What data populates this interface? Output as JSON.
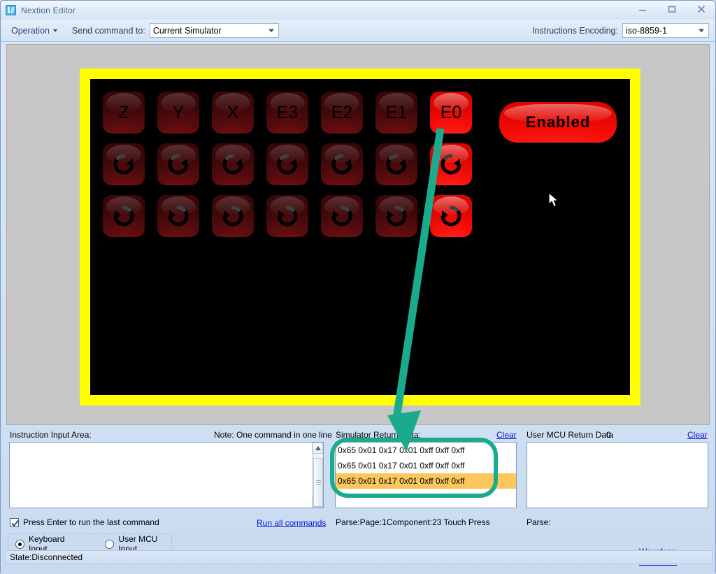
{
  "window": {
    "title": "Nextion Editor",
    "icon": "nextion-logo-icon",
    "minimize": "minimize-icon",
    "maximize": "maximize-icon",
    "close": "close-icon"
  },
  "toolbar": {
    "operation_menu": "Operation",
    "send_command_label": "Send command to:",
    "send_command_value": "Current Simulator",
    "encoding_label": "Instructions Encoding:",
    "encoding_value": "iso-8859-1"
  },
  "simulator": {
    "frame_color": "#ffff00",
    "screen_color": "#000000",
    "lit_color": "#f50d08",
    "dim_color": "#520b0e",
    "rows": [
      {
        "type": "label",
        "buttons": [
          {
            "label": "Z",
            "state": "dim"
          },
          {
            "label": "Y",
            "state": "dim"
          },
          {
            "label": "X",
            "state": "dim"
          },
          {
            "label": "E3",
            "state": "dim"
          },
          {
            "label": "E2",
            "state": "dim"
          },
          {
            "label": "E1",
            "state": "dim"
          },
          {
            "label": "E0",
            "state": "lit"
          }
        ]
      },
      {
        "type": "icon",
        "icon": "rotate-clockwise-icon",
        "buttons": [
          {
            "label": "",
            "state": "dim"
          },
          {
            "label": "",
            "state": "dim"
          },
          {
            "label": "",
            "state": "dim"
          },
          {
            "label": "",
            "state": "dim"
          },
          {
            "label": "",
            "state": "dim"
          },
          {
            "label": "",
            "state": "dim"
          },
          {
            "label": "",
            "state": "lit"
          }
        ]
      },
      {
        "type": "icon",
        "icon": "rotate-counterclockwise-icon",
        "buttons": [
          {
            "label": "",
            "state": "dim"
          },
          {
            "label": "",
            "state": "dim"
          },
          {
            "label": "",
            "state": "dim"
          },
          {
            "label": "",
            "state": "dim"
          },
          {
            "label": "",
            "state": "dim"
          },
          {
            "label": "",
            "state": "dim"
          },
          {
            "label": "",
            "state": "lit"
          }
        ]
      }
    ],
    "enable_button": {
      "label": "Enabled",
      "state": "lit"
    }
  },
  "instruction_panel": {
    "title": "Instruction Input Area:",
    "note": "Note: One command in one line",
    "input_value": "",
    "input_placeholder": "",
    "checkbox_label": "Press Enter to run the last command",
    "checkbox_checked": true,
    "run_all_link": "Run all commands",
    "radio_keyboard": "Keyboard Input",
    "radio_mcu": "User MCU Input",
    "radio_selected": "Keyboard Input"
  },
  "simulator_return": {
    "title": "Simulator Return Data:",
    "count": "3",
    "clear_link": "Clear",
    "rows": [
      {
        "text": "0x65 0x01 0x17 0x01 0xff 0xff 0xff",
        "selected": false
      },
      {
        "text": "0x65 0x01 0x17 0x01 0xff 0xff 0xff",
        "selected": false
      },
      {
        "text": "0x65 0x01 0x17 0x01 0xff 0xff 0xff",
        "selected": true
      }
    ],
    "parse": "Parse:Page:1Component:23 Touch Press"
  },
  "mcu_return": {
    "title": "User MCU Return Data",
    "count": "0",
    "clear_link": "Clear",
    "rows": [],
    "parse": "Parse:"
  },
  "footer": {
    "waveform_link": "Waveform Generator",
    "status": "State:Disconnected"
  },
  "annotation": {
    "color": "#1aab8c",
    "arrow_name": "callout-arrow",
    "highlight_name": "callout-rounded-rect"
  }
}
